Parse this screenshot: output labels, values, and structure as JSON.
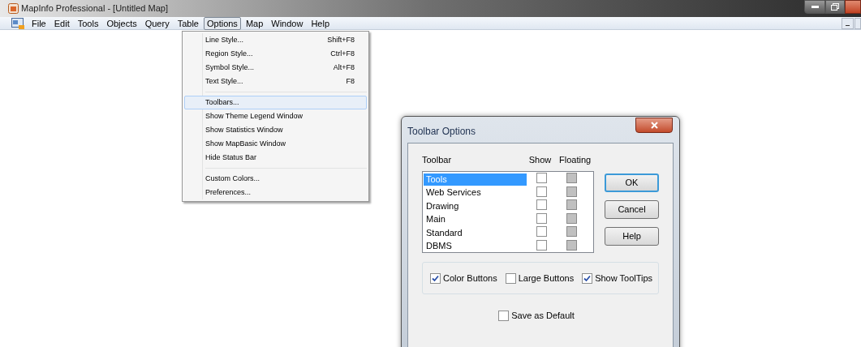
{
  "window": {
    "title": "MapInfo Professional - [Untitled Map]"
  },
  "menu_bar": [
    {
      "label": "File",
      "selected": false
    },
    {
      "label": "Edit",
      "selected": false
    },
    {
      "label": "Tools",
      "selected": false
    },
    {
      "label": "Objects",
      "selected": false
    },
    {
      "label": "Query",
      "selected": false
    },
    {
      "label": "Table",
      "selected": false
    },
    {
      "label": "Options",
      "selected": true
    },
    {
      "label": "Map",
      "selected": false
    },
    {
      "label": "Window",
      "selected": false
    },
    {
      "label": "Help",
      "selected": false
    }
  ],
  "options_menu": {
    "groups": [
      [
        {
          "label": "Line Style...",
          "shortcut": "Shift+F8",
          "selected": false
        },
        {
          "label": "Region Style...",
          "shortcut": "Ctrl+F8",
          "selected": false
        },
        {
          "label": "Symbol Style...",
          "shortcut": "Alt+F8",
          "selected": false
        },
        {
          "label": "Text Style...",
          "shortcut": "F8",
          "selected": false
        }
      ],
      [
        {
          "label": "Toolbars...",
          "selected": true
        },
        {
          "label": "Show Theme Legend Window",
          "selected": false
        },
        {
          "label": "Show Statistics Window",
          "selected": false
        },
        {
          "label": "Show MapBasic Window",
          "selected": false
        },
        {
          "label": "Hide Status Bar",
          "selected": false
        }
      ],
      [
        {
          "label": "Custom Colors...",
          "selected": false
        },
        {
          "label": "Preferences...",
          "selected": false
        }
      ]
    ]
  },
  "dialog": {
    "title": "Toolbar Options",
    "columns": [
      "Toolbar",
      "Show",
      "Floating"
    ],
    "toolbars": [
      {
        "name": "Tools",
        "selected": true,
        "show": false,
        "floating": false,
        "floating_disabled": true
      },
      {
        "name": "Web Services",
        "selected": false,
        "show": false,
        "floating": false,
        "floating_disabled": true
      },
      {
        "name": "Drawing",
        "selected": false,
        "show": false,
        "floating": false,
        "floating_disabled": true
      },
      {
        "name": "Main",
        "selected": false,
        "show": false,
        "floating": false,
        "floating_disabled": true
      },
      {
        "name": "Standard",
        "selected": false,
        "show": false,
        "floating": false,
        "floating_disabled": true
      },
      {
        "name": "DBMS",
        "selected": false,
        "show": false,
        "floating": false,
        "floating_disabled": true
      }
    ],
    "buttons": [
      {
        "label": "OK",
        "default": true
      },
      {
        "label": "Cancel",
        "default": false
      },
      {
        "label": "Help",
        "default": false
      }
    ],
    "options": [
      {
        "label": "Color Buttons",
        "checked": true
      },
      {
        "label": "Large Buttons",
        "checked": false
      },
      {
        "label": "Show ToolTips",
        "checked": true
      }
    ],
    "save_as_default": {
      "label": "Save as Default",
      "checked": false
    }
  }
}
